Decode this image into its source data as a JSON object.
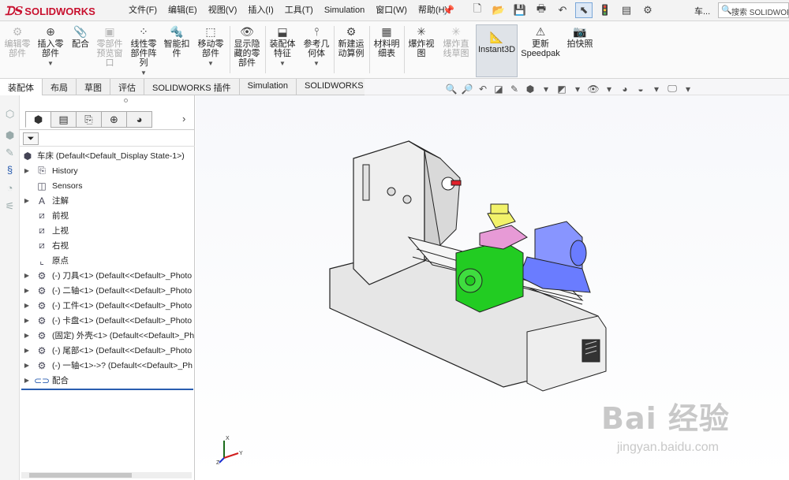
{
  "app": {
    "logo_text": "SOLIDWORKS",
    "doc_name": "车...",
    "search_placeholder": "搜索 SOLIDWORKS"
  },
  "menu": [
    "文件(F)",
    "编辑(E)",
    "视图(V)",
    "插入(I)",
    "工具(T)",
    "Simulation",
    "窗口(W)",
    "帮助(H)"
  ],
  "ribbon": {
    "b1": "编辑零\n部件",
    "b2": "插入零\n部件",
    "b3": "配合",
    "b4": "零部件\n预览窗\n口",
    "b5": "线性零\n部件阵\n列",
    "b6": "智能扣\n件",
    "b7": "移动零\n部件",
    "b8": "显示隐\n藏的零\n部件",
    "b9": "装配体\n特征",
    "b10": "参考几\n何体",
    "b11": "新建运\n动算例",
    "b12": "材料明\n细表",
    "b13": "爆炸视\n图",
    "b14": "爆炸直\n线草图",
    "b15": "Instant3D",
    "b16": "更新\nSpeedpak",
    "b17": "拍快照"
  },
  "tabs": [
    "装配体",
    "布局",
    "草图",
    "评估",
    "SOLIDWORKS 插件",
    "Simulation",
    "SOLIDWORKS MBD"
  ],
  "tree": {
    "root": "车床 (Default<Default_Display State-1>)",
    "items": [
      "History",
      "Sensors",
      "注解",
      "前视",
      "上视",
      "右视",
      "原点",
      "(-) 刀具<1> (Default<<Default>_Photo",
      "(-) 二轴<1> (Default<<Default>_Photo",
      "(-) 工件<1> (Default<<Default>_Photo",
      "(-) 卡盘<1> (Default<<Default>_Photo",
      "(固定) 外壳<1> (Default<<Default>_Ph",
      "(-) 尾部<1> (Default<<Default>_Photo",
      "(-) 一轴<1>->? (Default<<Default>_Ph",
      "配合"
    ]
  },
  "watermark": {
    "line1": "Bai 经验",
    "line2": "jingyan.baidu.com"
  },
  "colors": {
    "accent": "#2a5db0",
    "brand": "#c8102e",
    "part_green": "#22cc22",
    "part_blue": "#6a7cff",
    "part_pink": "#e79ad6",
    "part_yellow": "#f2f26a"
  }
}
